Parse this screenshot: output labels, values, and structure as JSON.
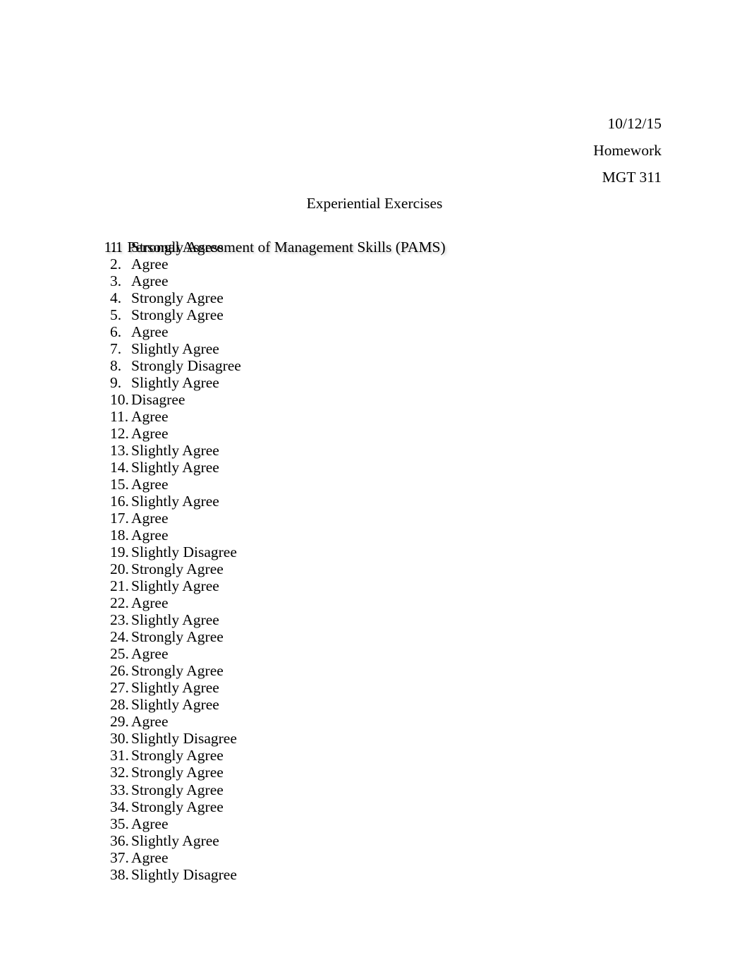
{
  "document": {
    "header_lines": [
      "10/12/15",
      "Homework",
      "MGT 311"
    ],
    "title": "Experiential Exercises",
    "section": {
      "number": "1.1",
      "heading": "Personal Assessment of Management Skills (PAMS)"
    },
    "answers": [
      {
        "number": "1.",
        "value": "Strongly Agree"
      },
      {
        "number": "2.",
        "value": "Agree"
      },
      {
        "number": "3.",
        "value": "Agree"
      },
      {
        "number": "4.",
        "value": "Strongly Agree"
      },
      {
        "number": "5.",
        "value": "Strongly Agree"
      },
      {
        "number": "6.",
        "value": "Agree"
      },
      {
        "number": "7.",
        "value": "Slightly Agree"
      },
      {
        "number": "8.",
        "value": "Strongly Disagree"
      },
      {
        "number": "9.",
        "value": "Slightly Agree"
      },
      {
        "number": "10.",
        "value": "Disagree"
      },
      {
        "number": "11.",
        "value": "Agree"
      },
      {
        "number": "12.",
        "value": "Agree"
      },
      {
        "number": "13.",
        "value": "Slightly Agree"
      },
      {
        "number": "14.",
        "value": "Slightly Agree"
      },
      {
        "number": "15.",
        "value": "Agree"
      },
      {
        "number": "16.",
        "value": "Slightly Agree"
      },
      {
        "number": "17.",
        "value": "Agree"
      },
      {
        "number": "18.",
        "value": "Agree"
      },
      {
        "number": "19.",
        "value": "Slightly Disagree"
      },
      {
        "number": "20.",
        "value": "Strongly Agree"
      },
      {
        "number": "21.",
        "value": "Slightly Agree"
      },
      {
        "number": "22.",
        "value": "Agree"
      },
      {
        "number": "23.",
        "value": "Slightly Agree"
      },
      {
        "number": "24.",
        "value": "Strongly Agree"
      },
      {
        "number": "25.",
        "value": "Agree"
      },
      {
        "number": "26.",
        "value": "Strongly Agree"
      },
      {
        "number": "27.",
        "value": "Slightly Agree"
      },
      {
        "number": "28.",
        "value": "Slightly Agree"
      },
      {
        "number": "29.",
        "value": "Agree"
      },
      {
        "number": "30.",
        "value": "Slightly Disagree"
      },
      {
        "number": "31.",
        "value": "Strongly Agree"
      },
      {
        "number": "32.",
        "value": "Strongly Agree"
      },
      {
        "number": "33.",
        "value": "Strongly Agree"
      },
      {
        "number": "34.",
        "value": "Strongly Agree"
      },
      {
        "number": "35.",
        "value": "Agree"
      },
      {
        "number": "36.",
        "value": "Slightly Agree"
      },
      {
        "number": "37.",
        "value": "Agree"
      },
      {
        "number": "38.",
        "value": "Slightly Disagree"
      }
    ]
  }
}
